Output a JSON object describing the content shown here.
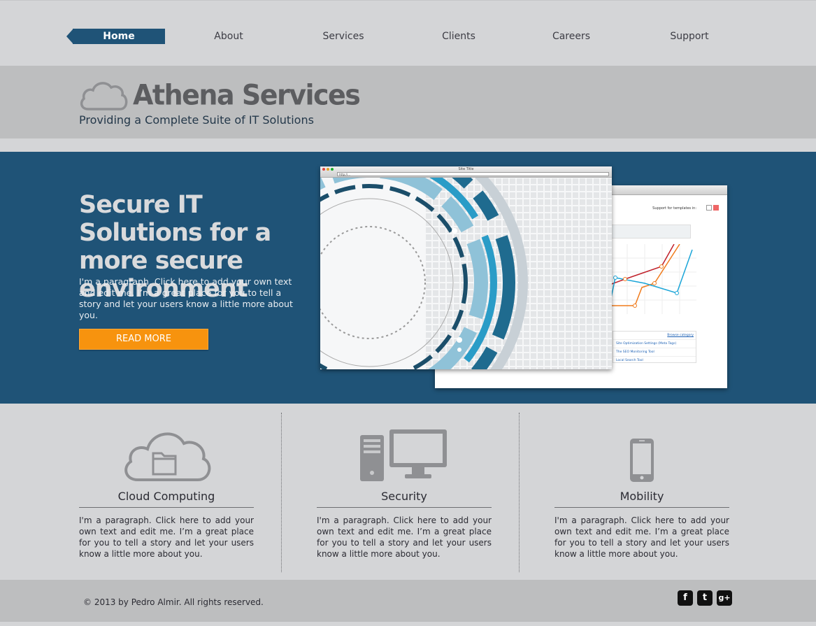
{
  "nav": {
    "items": [
      {
        "label": "Home",
        "active": true
      },
      {
        "label": "About"
      },
      {
        "label": "Services"
      },
      {
        "label": "Clients"
      },
      {
        "label": "Careers"
      },
      {
        "label": "Support"
      }
    ]
  },
  "brand": {
    "title": "Athena Services",
    "tagline": "Providing a Complete Suite of IT Solutions",
    "logo_icon": "cloud-outline-icon"
  },
  "hero": {
    "title": "Secure IT Solutions for a more secure environment",
    "paragraph": "I'm a paragraph. Click here to add your own text and edit me. I’m a great place for you to tell a story and let your users know a little more about you.",
    "button_label": "READ MORE",
    "mock_front": {
      "window_title": "Site Title",
      "url": "http://..."
    },
    "mock_back": {
      "support_text": "Support for templates in:",
      "browse_link": "Browse category",
      "list": [
        "Site Optimization Settings (Meta Tags)",
        "The SEO Monitoring Tool",
        "Local Search Tool"
      ]
    }
  },
  "features": [
    {
      "title": "Cloud Computing",
      "icon": "cloud-folder-icon",
      "text": "I'm a paragraph. Click here to add your own text and edit me. I’m a great place for you to tell a story and let your users know a little more about you."
    },
    {
      "title": "Security",
      "icon": "desktop-computer-icon",
      "text": "I'm a paragraph. Click here to add your own text and edit me. I’m a great place for you to tell a story and let your users know a little more about you."
    },
    {
      "title": "Mobility",
      "icon": "smartphone-icon",
      "text": "I'm a paragraph. Click here to add your own text and edit me. I’m a great place for you to tell a story and let your users know a little more about you."
    }
  ],
  "footer": {
    "copyright": "© 2013 by Pedro Almir. All rights reserved.",
    "social": [
      {
        "icon": "facebook-icon",
        "glyph": "f"
      },
      {
        "icon": "twitter-icon",
        "glyph": "t"
      },
      {
        "icon": "google-plus-icon",
        "glyph": "g+"
      }
    ]
  },
  "colors": {
    "primary": "#1f5377",
    "accent": "#f7930e",
    "page_bg": "#d4d5d7",
    "band_bg": "#bdbebf"
  }
}
